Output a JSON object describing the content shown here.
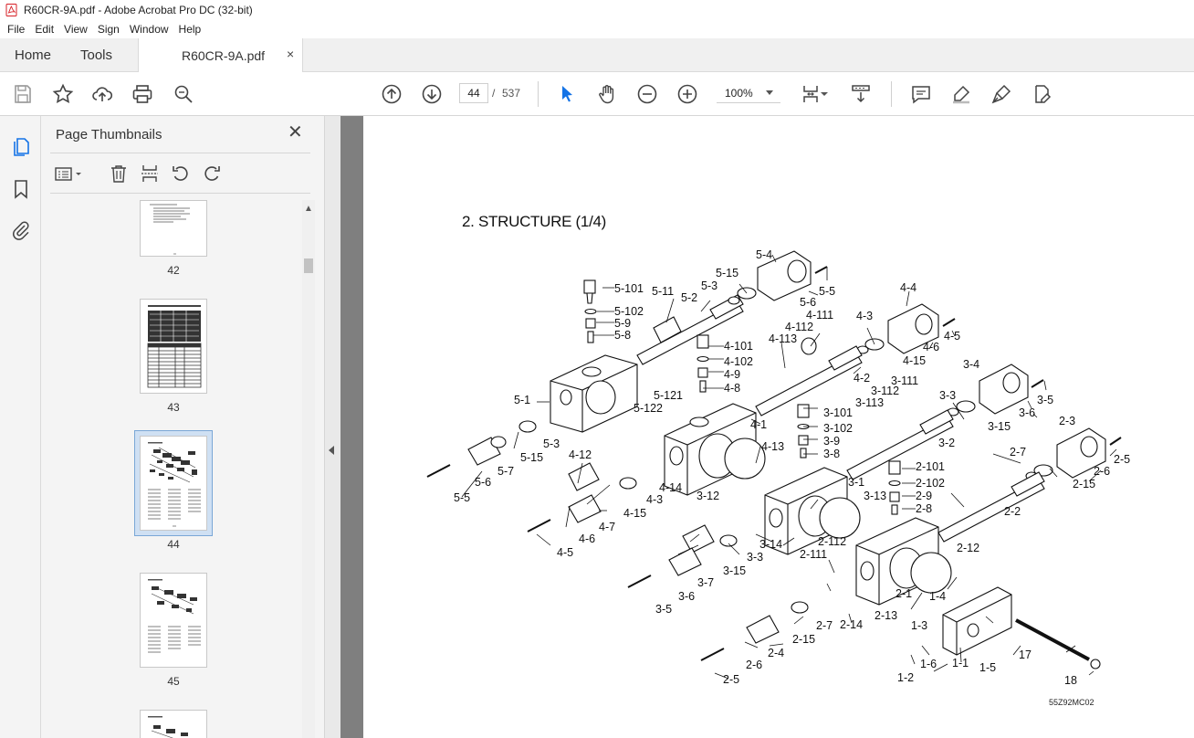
{
  "window": {
    "title": "R60CR-9A.pdf - Adobe Acrobat Pro DC (32-bit)"
  },
  "menu": [
    "File",
    "Edit",
    "View",
    "Sign",
    "Window",
    "Help"
  ],
  "tabs": {
    "home": "Home",
    "tools": "Tools",
    "document": "R60CR-9A.pdf",
    "close": "×"
  },
  "toolbar": {
    "current_page": "44",
    "page_separator": "/",
    "total_pages": "537",
    "zoom": "100%"
  },
  "thumbnails": {
    "title": "Page Thumbnails",
    "close": "✕",
    "pages": [
      "42",
      "43",
      "44",
      "45"
    ],
    "selected_page": "44"
  },
  "document": {
    "heading": "2. STRUCTURE (1/4)",
    "reference_code": "55Z92MC02",
    "callouts": [
      "5-4",
      "5-15",
      "5-3",
      "5-101",
      "5-11",
      "5-2",
      "5-6",
      "5-5",
      "5-102",
      "5-9",
      "5-8",
      "4-111",
      "4-112",
      "4-113",
      "4-4",
      "4-3",
      "4-101",
      "4-102",
      "4-9",
      "4-8",
      "4-15",
      "4-6",
      "4-5",
      "5-1",
      "5-121",
      "5-122",
      "4-2",
      "3-111",
      "3-112",
      "3-113",
      "3-4",
      "3-3",
      "3-6",
      "3-5",
      "4-1",
      "3-101",
      "3-102",
      "3-15",
      "3-9",
      "5-3",
      "3-8",
      "3-2",
      "2-3",
      "4-12",
      "4-13",
      "5-15",
      "5-7",
      "2-101",
      "2-7",
      "2-5",
      "2-102",
      "2-6",
      "5-6",
      "5-5",
      "4-14",
      "3-1",
      "2-15",
      "2-9",
      "4-3",
      "3-12",
      "3-13",
      "2-8",
      "2-2",
      "4-15",
      "4-7",
      "4-6",
      "3-14",
      "4-5",
      "2-112",
      "2-12",
      "3-3",
      "2-111",
      "3-15",
      "3-7",
      "2-1",
      "1-4",
      "3-6",
      "3-5",
      "2-14",
      "2-13",
      "2-7",
      "2-15",
      "1-3",
      "2-4",
      "1-6",
      "1-1",
      "1-5",
      "17",
      "2-6",
      "2-5",
      "1-2",
      "18"
    ]
  }
}
